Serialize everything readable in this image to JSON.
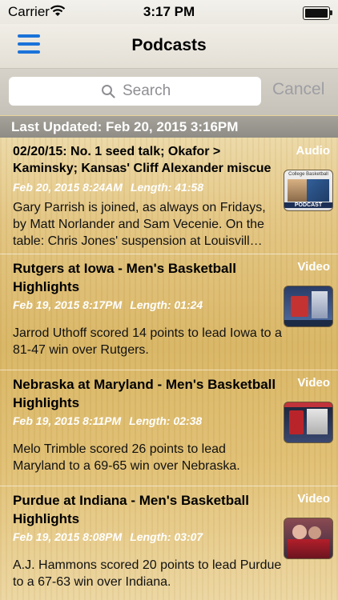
{
  "status_bar": {
    "carrier": "Carrier",
    "time": "3:17 PM"
  },
  "nav": {
    "title": "Podcasts"
  },
  "search": {
    "placeholder": "Search",
    "cancel_label": "Cancel"
  },
  "last_updated": "Last Updated: Feb 20, 2015 3:16PM",
  "items": [
    {
      "type": "Audio",
      "title": "02/20/15: No. 1 seed talk; Okafor > Kaminsky; Kansas' Cliff Alexander miscue",
      "date": "Feb 20, 2015 8:24AM",
      "length": "Length: 41:58",
      "description": "Gary Parrish is joined, as always on Fridays, by Matt Norlander and Sam Vecenie. On the table: Chris Jones' suspension at Louisvill…",
      "thumb_text_top": "College Basketball",
      "thumb_text_bottom": "PODCAST"
    },
    {
      "type": "Video",
      "title": "Rutgers at Iowa - Men's Basketball Highlights",
      "date": "Feb 19, 2015 8:17PM",
      "length": "Length: 01:24",
      "description": "Jarrod Uthoff scored 14 points to lead Iowa to a 81-47 win over Rutgers."
    },
    {
      "type": "Video",
      "title": "Nebraska at Maryland - Men's Basketball Highlights",
      "date": "Feb 19, 2015 8:11PM",
      "length": "Length: 02:38",
      "description": "Melo Trimble scored 26 points to lead Maryland to a 69-65 win over Nebraska."
    },
    {
      "type": "Video",
      "title": "Purdue at Indiana - Men's Basketball Highlights",
      "date": "Feb 19, 2015 8:08PM",
      "length": "Length: 03:07",
      "description": "A.J. Hammons scored 20 points to lead Purdue to a 67-63 win over Indiana."
    }
  ],
  "colors": {
    "accent": "#1a73d9",
    "meta_text": "#ffffff"
  }
}
